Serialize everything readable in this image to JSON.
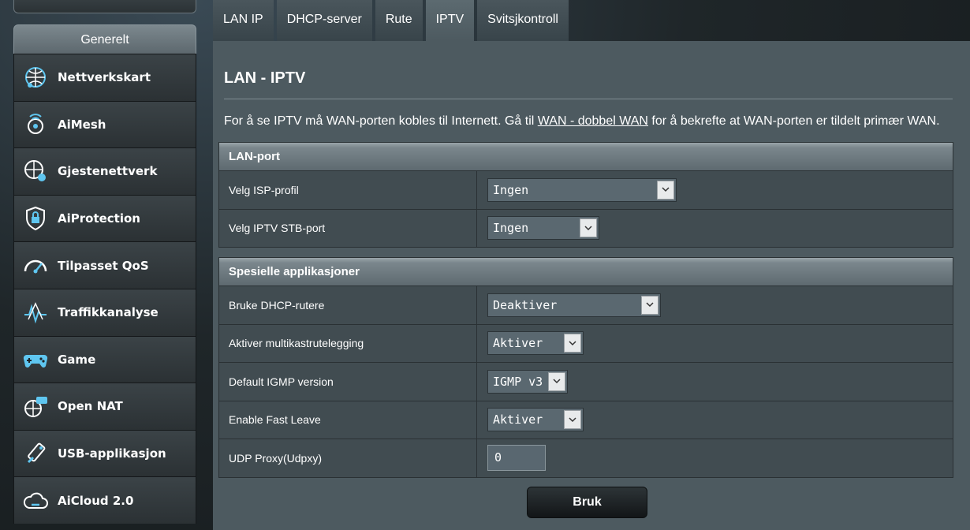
{
  "sidebar": {
    "header": "Generelt",
    "items": [
      {
        "label": "Nettverkskart",
        "icon": "network-map-icon"
      },
      {
        "label": "AiMesh",
        "icon": "aimesh-icon"
      },
      {
        "label": "Gjestenettverk",
        "icon": "guest-network-icon"
      },
      {
        "label": "AiProtection",
        "icon": "aiprotection-icon"
      },
      {
        "label": "Tilpasset QoS",
        "icon": "qos-icon"
      },
      {
        "label": "Traffikkanalyse",
        "icon": "traffic-analyzer-icon"
      },
      {
        "label": "Game",
        "icon": "gamepad-icon"
      },
      {
        "label": "Open NAT",
        "icon": "open-nat-icon"
      },
      {
        "label": "USB-applikasjon",
        "icon": "usb-icon"
      },
      {
        "label": "AiCloud 2.0",
        "icon": "cloud-icon"
      }
    ]
  },
  "tabs": [
    {
      "label": "LAN IP"
    },
    {
      "label": "DHCP-server"
    },
    {
      "label": "Rute"
    },
    {
      "label": "IPTV",
      "active": true
    },
    {
      "label": "Svitsjkontroll"
    }
  ],
  "main": {
    "title": "LAN - IPTV",
    "description_before": "For å se IPTV må WAN-porten kobles til Internett. Gå til ",
    "description_link": "WAN - dobbel WAN",
    "description_after": " for å bekrefte at WAN-porten er tildelt primær WAN.",
    "lan_port": {
      "title": "LAN-port",
      "rows": [
        {
          "label": "Velg ISP-profil",
          "value": "Ingen"
        },
        {
          "label": "Velg IPTV STB-port",
          "value": "Ingen"
        }
      ]
    },
    "special": {
      "title": "Spesielle applikasjoner",
      "rows": [
        {
          "label": "Bruke DHCP-rutere",
          "value": "Deaktiver"
        },
        {
          "label": "Aktiver multikastrutelegging",
          "value": "Aktiver"
        },
        {
          "label": "Default IGMP version",
          "value": "IGMP v3"
        },
        {
          "label": "Enable Fast Leave",
          "value": "Aktiver"
        },
        {
          "label": "UDP Proxy(Udpxy)",
          "value": "0"
        }
      ]
    },
    "apply_label": "Bruk"
  },
  "colors": {
    "panel": "#4d5a60",
    "sidebar_item": "#2b3134",
    "accent_icon": "#5fc6f0"
  }
}
